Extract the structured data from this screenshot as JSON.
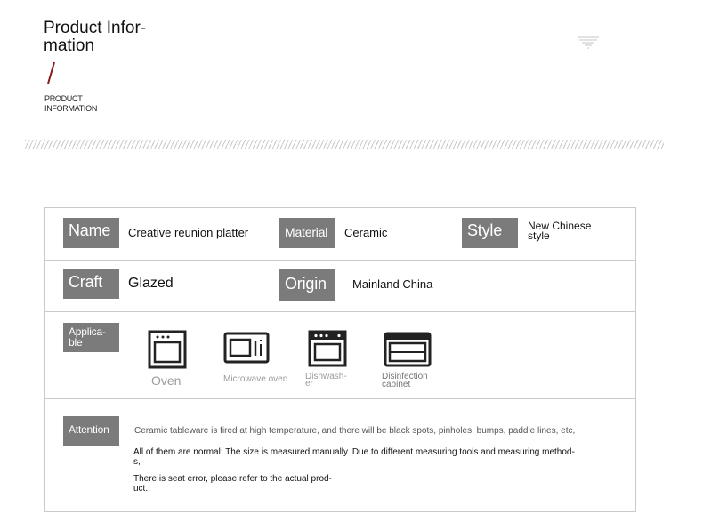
{
  "header": {
    "title": "Product Infor-\nmation",
    "subtitle": "PRODUCT\nINFORMATION"
  },
  "colors": {
    "label_bg": "#7b7b7b",
    "accent": "#8b1a1a",
    "border": "#c9c9c9"
  },
  "rows": {
    "name": {
      "label": "Name",
      "value": "Creative reunion platter"
    },
    "material": {
      "label": "Material",
      "value": "Ceramic"
    },
    "style": {
      "label": "Style",
      "value": "New Chinese\nstyle"
    },
    "craft": {
      "label": "Craft",
      "value": "Glazed"
    },
    "origin": {
      "label": "Origin",
      "value": "Mainland China"
    },
    "applicable": {
      "label": "Applica-\nble",
      "items": [
        {
          "icon": "oven-icon",
          "caption": "Oven"
        },
        {
          "icon": "microwave-icon",
          "caption": "Microwave oven"
        },
        {
          "icon": "dishwasher-icon",
          "caption": "Dishwash-\ner"
        },
        {
          "icon": "disinfection-cabinet-icon",
          "caption": "Disinfection\ncabinet"
        }
      ]
    },
    "attention": {
      "label": "Attention",
      "lines": [
        "Ceramic tableware is fired at high temperature, and there will be black spots, pinholes, bumps, paddle lines, etc,",
        "All of them are normal; The size is measured manually. Due to different measuring tools and measuring method-\ns,",
        "There is seat error, please refer to the actual prod-\nuct."
      ]
    }
  }
}
